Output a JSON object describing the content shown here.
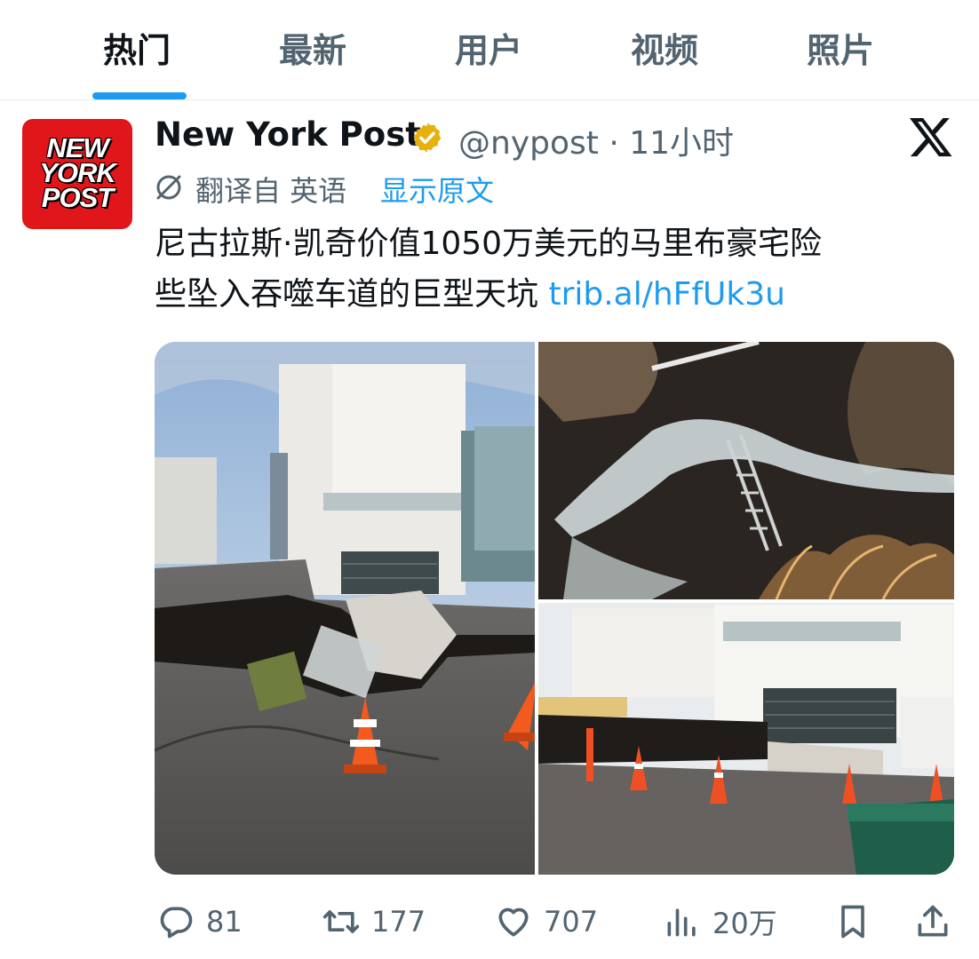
{
  "tabs": [
    {
      "label": "热门",
      "active": true
    },
    {
      "label": "最新",
      "active": false
    },
    {
      "label": "用户",
      "active": false
    },
    {
      "label": "视频",
      "active": false
    },
    {
      "label": "照片",
      "active": false
    }
  ],
  "post": {
    "author_name": "New York Post",
    "handle_time": "@nypost · 11小时",
    "avatar_lines": [
      "NEW",
      "YORK",
      "POST"
    ],
    "translated_from": "翻译自 英语",
    "show_original": "显示原文",
    "text_line1": "尼古拉斯·凯奇价值1050万美元的马里布豪宅险",
    "text_line2": "些坠入吞噬车道的巨型天坑 ",
    "link": "trib.al/hFfUk3u"
  },
  "actions": {
    "replies": "81",
    "retweets": "177",
    "likes": "707",
    "views": "20万"
  },
  "colors": {
    "accent": "#1d9bf0",
    "secondary_text": "#536471",
    "avatar_bg": "#e0161b",
    "verified_badge": "#e8b00c"
  },
  "icons": [
    "translate-icon",
    "verified-icon",
    "x-logo-icon",
    "reply-icon",
    "retweet-icon",
    "like-icon",
    "views-icon",
    "bookmark-icon",
    "share-icon"
  ]
}
